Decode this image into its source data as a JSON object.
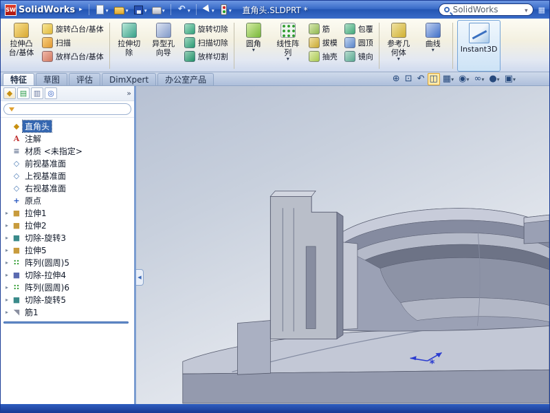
{
  "titlebar": {
    "logo_text": "SW",
    "app_name": "SolidWorks",
    "doc_title": "直角头.SLDPRT *",
    "search_text": "SolidWorks",
    "toolbar_icons": [
      "new-document-icon",
      "open-icon",
      "save-icon",
      "print-icon",
      "undo-icon",
      "select-arrow-icon",
      "rebuild-traffic-light-icon"
    ]
  },
  "ribbon": {
    "extrude_boss": "拉伸凸\n台/基体",
    "revolve_boss": "旋转凸台/基体",
    "sweep": "扫描",
    "loft_boss": "放样凸台/基体",
    "extrude_cut": "拉伸切\n除",
    "hole_wizard": "异型孔\n向导",
    "revolve_cut": "旋转切除",
    "sweep_cut": "扫描切除",
    "loft_cut": "放样切割",
    "fillet": "圆角",
    "linear_pattern": "线性阵\n列",
    "rib": "筋",
    "draft": "拔模",
    "shell": "抽壳",
    "wrap": "包覆",
    "dome": "圆顶",
    "mirror": "镜向",
    "ref_geometry": "参考几\n何体",
    "curves": "曲线",
    "instant3d": "Instant3D"
  },
  "tabs": {
    "items": [
      {
        "label": "特征",
        "cls": "active"
      },
      {
        "label": "草图",
        "cls": ""
      },
      {
        "label": "评估",
        "cls": ""
      },
      {
        "label": "DimXpert",
        "cls": ""
      },
      {
        "label": "办公室产品",
        "cls": ""
      }
    ]
  },
  "hud": {
    "items": [
      {
        "glyph": "⊕",
        "arrow": "",
        "cls": "",
        "name": "zoom-fit-button"
      },
      {
        "glyph": "⊡",
        "arrow": "",
        "cls": "",
        "name": "zoom-area-button"
      },
      {
        "glyph": "↶",
        "arrow": "",
        "cls": "",
        "name": "previous-view-button"
      },
      {
        "glyph": "◫",
        "arrow": "",
        "cls": "active",
        "name": "section-view-button"
      },
      {
        "glyph": "▦",
        "arrow": "▾",
        "cls": "",
        "name": "view-orientation-button"
      },
      {
        "glyph": "◉",
        "arrow": "▾",
        "cls": "",
        "name": "display-style-button"
      },
      {
        "glyph": "∞",
        "arrow": "▾",
        "cls": "",
        "name": "hide-show-items-button"
      },
      {
        "glyph": "●",
        "arrow": "▾",
        "cls": "",
        "name": "edit-appearance-button"
      },
      {
        "glyph": "▣",
        "arrow": "▾",
        "cls": "",
        "name": "apply-scene-button"
      }
    ]
  },
  "panel": {
    "manager_tabs": [
      {
        "glyph": "◆",
        "cls": "mt-gold",
        "name": "featuremanager-tab"
      },
      {
        "glyph": "▤",
        "cls": "mt-green",
        "name": "propertymanager-tab"
      },
      {
        "glyph": "▥",
        "cls": "mt-slate",
        "name": "configurationmanager-tab"
      },
      {
        "glyph": "◎",
        "cls": "mt-blue",
        "name": "dimxpertmanager-tab"
      }
    ],
    "more_label": "»",
    "tree": [
      {
        "arrow": "",
        "glyph": "◆",
        "icon": "i-gold",
        "label": "直角头",
        "cls": "sel"
      },
      {
        "arrow": "",
        "glyph": "A",
        "icon": "i-annot",
        "label": "注解",
        "cls": ""
      },
      {
        "arrow": "",
        "glyph": "≡",
        "icon": "i-mat",
        "label": "材质 <未指定>",
        "cls": ""
      },
      {
        "arrow": "",
        "glyph": "◇",
        "icon": "i-plane",
        "label": "前视基准面",
        "cls": ""
      },
      {
        "arrow": "",
        "glyph": "◇",
        "icon": "i-plane",
        "label": "上视基准面",
        "cls": ""
      },
      {
        "arrow": "",
        "glyph": "◇",
        "icon": "i-plane",
        "label": "右视基准面",
        "cls": ""
      },
      {
        "arrow": "",
        "glyph": "+",
        "icon": "i-origin",
        "label": "原点",
        "cls": ""
      },
      {
        "arrow": "▸",
        "glyph": "■",
        "icon": "i-ext",
        "label": "拉伸1",
        "cls": ""
      },
      {
        "arrow": "▸",
        "glyph": "■",
        "icon": "i-ext",
        "label": "拉伸2",
        "cls": ""
      },
      {
        "arrow": "▸",
        "glyph": "■",
        "icon": "i-cutr",
        "label": "切除-旋转3",
        "cls": ""
      },
      {
        "arrow": "▸",
        "glyph": "■",
        "icon": "i-ext",
        "label": "拉伸5",
        "cls": ""
      },
      {
        "arrow": "▸",
        "glyph": "∷",
        "icon": "i-pat",
        "label": "阵列(圆周)5",
        "cls": ""
      },
      {
        "arrow": "▸",
        "glyph": "■",
        "icon": "i-cute",
        "label": "切除-拉伸4",
        "cls": ""
      },
      {
        "arrow": "▸",
        "glyph": "∷",
        "icon": "i-pat",
        "label": "阵列(圆周)6",
        "cls": ""
      },
      {
        "arrow": "▸",
        "glyph": "■",
        "icon": "i-cutr",
        "label": "切除-旋转5",
        "cls": ""
      },
      {
        "arrow": "▸",
        "glyph": "◥",
        "icon": "i-rib",
        "label": "筋1",
        "cls": ""
      }
    ]
  },
  "colors": {
    "titlebar_blue": "#2f63c4",
    "selection_blue": "#3466b0",
    "instant3d_active_border": "#74a4d8",
    "hud_active_highlight": "#ffe9a6",
    "model_gray": "#9ba1b5"
  }
}
